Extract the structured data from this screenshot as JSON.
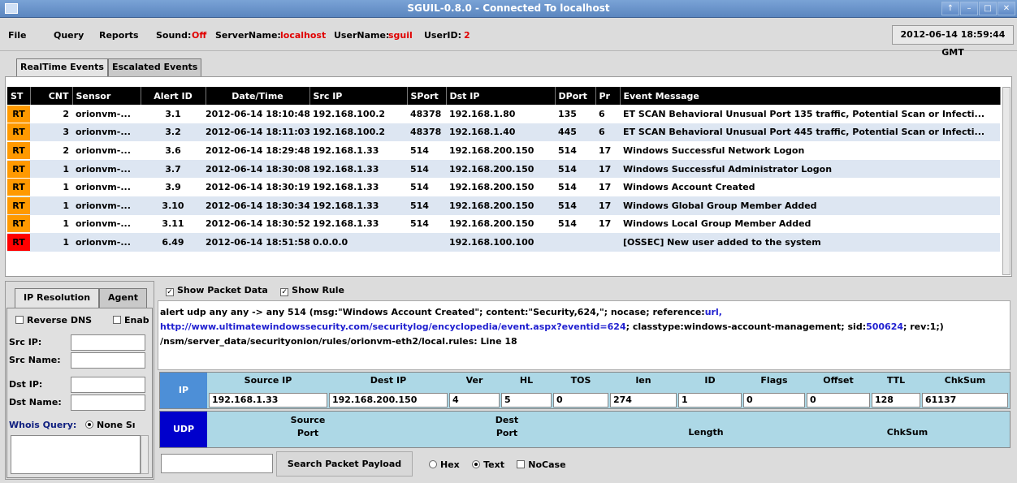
{
  "window": {
    "title": "SGUIL-0.8.0 - Connected To localhost"
  },
  "menu": {
    "file": "File",
    "query": "Query",
    "reports": "Reports",
    "sound_label": "Sound:",
    "sound_value": "Off",
    "servername_label": "ServerName:",
    "servername_value": "localhost",
    "username_label": "UserName:",
    "username_value": "sguil",
    "userid_label": "UserID:",
    "userid_value": "2",
    "clock": "2012-06-14 18:59:44 GMT"
  },
  "tabs": [
    "RealTime Events",
    "Escalated Events"
  ],
  "events": {
    "columns": [
      "ST",
      "CNT",
      "Sensor",
      "Alert ID",
      "Date/Time",
      "Src IP",
      "SPort",
      "Dst IP",
      "DPort",
      "Pr",
      "Event Message"
    ],
    "rows": [
      {
        "st": "RT",
        "st_color": "#ff9900",
        "cnt": "2",
        "sensor": "orionvm-...",
        "alert_id": "3.1",
        "datetime": "2012-06-14 18:10:48",
        "src_ip": "192.168.100.2",
        "sport": "48378",
        "dst_ip": "192.168.1.80",
        "dport": "135",
        "pr": "6",
        "message": "ET SCAN Behavioral Unusual Port 135 traffic, Potential Scan or Infecti..."
      },
      {
        "st": "RT",
        "st_color": "#ff9900",
        "cnt": "3",
        "sensor": "orionvm-...",
        "alert_id": "3.2",
        "datetime": "2012-06-14 18:11:03",
        "src_ip": "192.168.100.2",
        "sport": "48378",
        "dst_ip": "192.168.1.40",
        "dport": "445",
        "pr": "6",
        "message": "ET SCAN Behavioral Unusual Port 445 traffic, Potential Scan or Infecti..."
      },
      {
        "st": "RT",
        "st_color": "#ff9900",
        "cnt": "2",
        "sensor": "orionvm-...",
        "alert_id": "3.6",
        "datetime": "2012-06-14 18:29:48",
        "src_ip": "192.168.1.33",
        "sport": "514",
        "dst_ip": "192.168.200.150",
        "dport": "514",
        "pr": "17",
        "message": "Windows Successful Network Logon"
      },
      {
        "st": "RT",
        "st_color": "#ff9900",
        "cnt": "1",
        "sensor": "orionvm-...",
        "alert_id": "3.7",
        "datetime": "2012-06-14 18:30:08",
        "src_ip": "192.168.1.33",
        "sport": "514",
        "dst_ip": "192.168.200.150",
        "dport": "514",
        "pr": "17",
        "message": "Windows Successful Administrator Logon"
      },
      {
        "st": "RT",
        "st_color": "#ff9900",
        "cnt": "1",
        "sensor": "orionvm-...",
        "alert_id": "3.9",
        "datetime": "2012-06-14 18:30:19",
        "src_ip": "192.168.1.33",
        "sport": "514",
        "dst_ip": "192.168.200.150",
        "dport": "514",
        "pr": "17",
        "message": "Windows Account Created"
      },
      {
        "st": "RT",
        "st_color": "#ff9900",
        "cnt": "1",
        "sensor": "orionvm-...",
        "alert_id": "3.10",
        "datetime": "2012-06-14 18:30:34",
        "src_ip": "192.168.1.33",
        "sport": "514",
        "dst_ip": "192.168.200.150",
        "dport": "514",
        "pr": "17",
        "message": "Windows Global Group Member Added"
      },
      {
        "st": "RT",
        "st_color": "#ff9900",
        "cnt": "1",
        "sensor": "orionvm-...",
        "alert_id": "3.11",
        "datetime": "2012-06-14 18:30:52",
        "src_ip": "192.168.1.33",
        "sport": "514",
        "dst_ip": "192.168.200.150",
        "dport": "514",
        "pr": "17",
        "message": "Windows Local Group Member Added"
      },
      {
        "st": "RT",
        "st_color": "#ff0000",
        "cnt": "1",
        "sensor": "orionvm-...",
        "alert_id": "6.49",
        "datetime": "2012-06-14 18:51:58",
        "src_ip": "0.0.0.0",
        "sport": "",
        "dst_ip": "192.168.100.100",
        "dport": "",
        "pr": "",
        "message": "[OSSEC] New user added to the system"
      }
    ]
  },
  "left_panel": {
    "tabs": [
      "IP Resolution",
      "Agent"
    ],
    "reverse_dns": "Reverse DNS",
    "enable": "Enab",
    "src_ip": "Src IP:",
    "src_name": "Src Name:",
    "dst_ip": "Dst IP:",
    "dst_name": "Dst Name:",
    "whois_label": "Whois Query:",
    "whois_option": "None Sı"
  },
  "rule_panel": {
    "show_packet_data": "Show Packet Data",
    "show_rule": "Show Rule",
    "rule_part1": "alert udp any any -> any 514 (msg:\"Windows Account Created\"; content:\"Security,624,\"; nocase; reference:",
    "rule_url_label": "url,",
    "rule_url": "http://www.ultimatewindowssecurity.com/securitylog/encyclopedia/event.aspx?eventid=624",
    "rule_part2": "; classtype:windows-account-management; sid:",
    "rule_sid": "500624",
    "rule_part3": "; rev:1;)",
    "rule_path": "/nsm/server_data/securityonion/rules/orionvm-eth2/local.rules: Line 18"
  },
  "ip_header": {
    "label": "IP",
    "headers": [
      "Source IP",
      "Dest IP",
      "Ver",
      "HL",
      "TOS",
      "len",
      "ID",
      "Flags",
      "Offset",
      "TTL",
      "ChkSum"
    ],
    "values": [
      "192.168.1.33",
      "192.168.200.150",
      "4",
      "5",
      "0",
      "274",
      "1",
      "0",
      "0",
      "128",
      "61137"
    ]
  },
  "udp_header": {
    "label": "UDP",
    "source_port_1": "Source",
    "source_port_2": "Port",
    "dest_port_1": "Dest",
    "dest_port_2": "Port",
    "length": "Length",
    "chksum": "ChkSum"
  },
  "search": {
    "button": "Search Packet Payload",
    "hex": "Hex",
    "text": "Text",
    "nocase": "NoCase"
  },
  "colors": {
    "title_bar": "#5b86bf",
    "alert_orange": "#ff9900",
    "alert_red": "#ff0000",
    "header_bg": "#000000",
    "packet_bg": "#add8e6"
  }
}
